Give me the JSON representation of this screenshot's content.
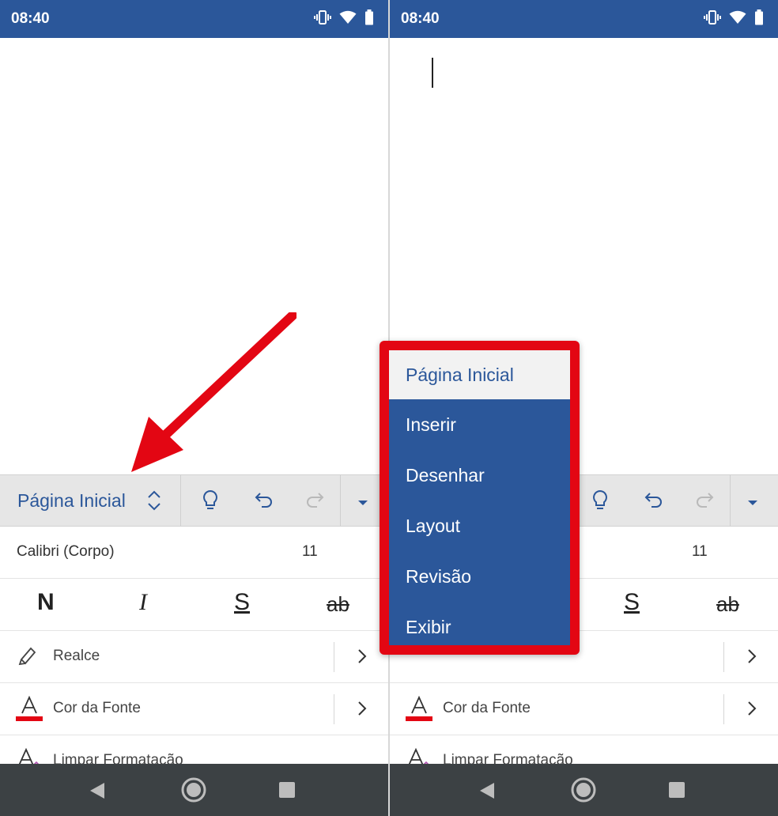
{
  "status_bar": {
    "time": "08:40"
  },
  "ribbon": {
    "active_tab": "Página Inicial"
  },
  "font": {
    "name": "Calibri (Corpo)",
    "size": "11"
  },
  "format_buttons": {
    "bold": "N",
    "italic": "I",
    "underline": "S",
    "strikethrough": "ab"
  },
  "list": [
    {
      "label": "Realce",
      "icon": "highlighter-icon"
    },
    {
      "label": "Cor da Fonte",
      "icon": "font-color-icon"
    },
    {
      "label": "Limpar Formatação",
      "icon": "clear-formatting-icon"
    }
  ],
  "menu": {
    "items": [
      "Página Inicial",
      "Inserir",
      "Desenhar",
      "Layout",
      "Revisão",
      "Exibir"
    ],
    "selected": "Página Inicial"
  },
  "colors": {
    "accent": "#2b579a",
    "highlight_frame": "#e30613",
    "font_color_underline": "#e30613",
    "navbar": "#3c4144",
    "ribbon_bg": "#e6e6e6"
  }
}
